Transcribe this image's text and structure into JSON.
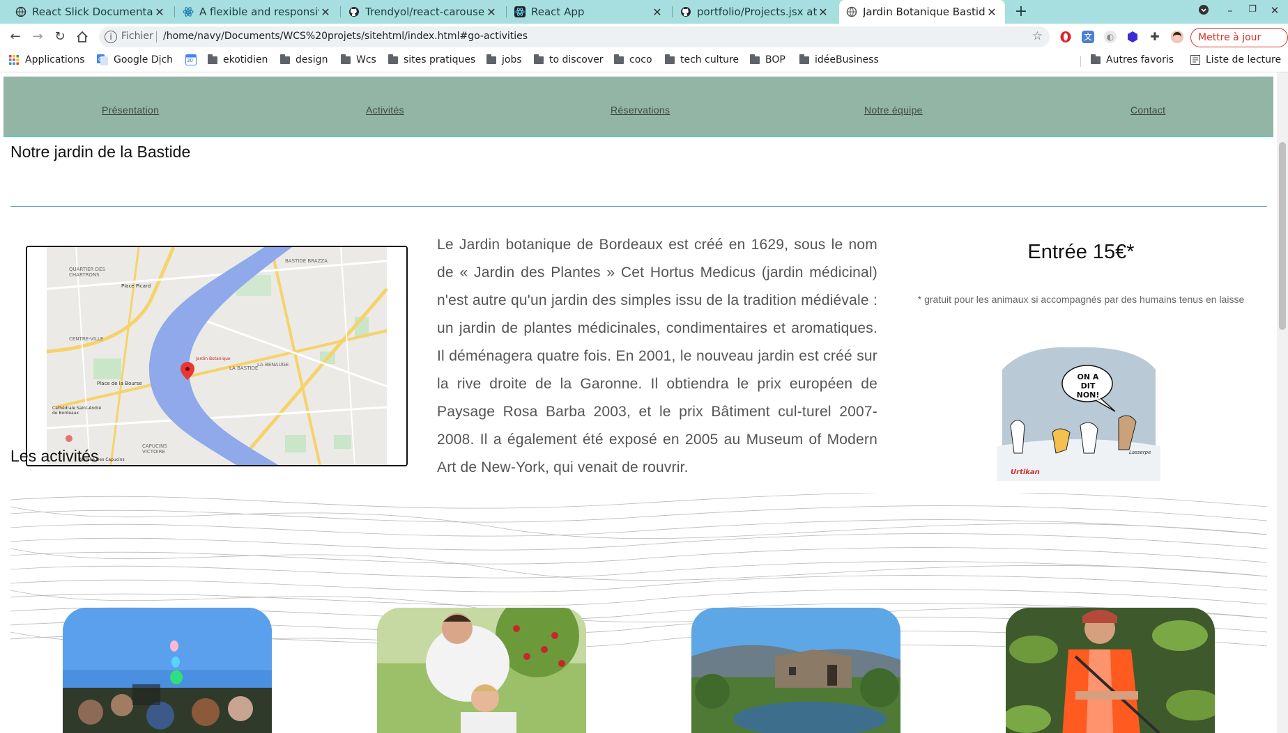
{
  "browser": {
    "tabs": [
      {
        "title": "React Slick Documentatio",
        "icon": "globe-icon"
      },
      {
        "title": "A flexible and responsive",
        "icon": "react-icon"
      },
      {
        "title": "Trendyol/react-carousel: I",
        "icon": "github-icon"
      },
      {
        "title": "React App",
        "icon": "react-icon"
      },
      {
        "title": "portfolio/Projects.jsx at n",
        "icon": "github-icon"
      },
      {
        "title": "Jardin Botanique Bastide",
        "icon": "globe-icon",
        "active": true
      }
    ],
    "new_tab": "+",
    "address": {
      "scheme": "Fichier",
      "url": "/home/navy/Documents/WCS%20projets/sitehtml/index.html#go-activities"
    },
    "update_button": "Mettre à jour",
    "bookmarks": [
      {
        "label": "Applications",
        "icon": "apps-grid-icon"
      },
      {
        "label": "Google Dịch",
        "icon": "translate-icon"
      },
      {
        "label": "",
        "icon": "calendar-icon",
        "text": "30"
      },
      {
        "label": "ekotidien",
        "icon": "folder-icon"
      },
      {
        "label": "design",
        "icon": "folder-icon"
      },
      {
        "label": "Wcs",
        "icon": "folder-icon"
      },
      {
        "label": "sites pratiques",
        "icon": "folder-icon"
      },
      {
        "label": "jobs",
        "icon": "folder-icon"
      },
      {
        "label": "to discover",
        "icon": "folder-icon"
      },
      {
        "label": "coco",
        "icon": "folder-icon"
      },
      {
        "label": "tech culture",
        "icon": "folder-icon"
      },
      {
        "label": "BOP",
        "icon": "folder-icon"
      },
      {
        "label": "idéeBusiness",
        "icon": "folder-icon"
      }
    ],
    "bookmarks_right": [
      {
        "label": "Autres favoris",
        "icon": "folder-icon"
      },
      {
        "label": "Liste de lecture",
        "icon": "reading-list-icon"
      }
    ]
  },
  "site": {
    "nav": [
      "Présentation",
      "Activités",
      "Réservations",
      "Notre équipe",
      "Contact"
    ],
    "section1_title": "Notre jardin de la Bastide",
    "description": "Le Jardin botanique de Bordeaux est créé en 1629, sous le nom de « Jardin des Plantes » Cet Hortus Medicus (jardin médicinal) n'est autre qu'un jardin des simples issu de la tradition médiévale : un jardin de plantes médicinales, condimentaires et aromatiques. Il déménagera quatre fois. En 2001, le nouveau jardin est créé sur la rive droite de la Garonne. Il obtiendra le prix européen de Paysage Rosa Barba 2003, et le prix Bâtiment cul-turel 2007-2008. Il a également été exposé en 2005 au Museum of Modern Art de New-York, qui venait de rouvrir.",
    "price_title": "Entrée 15€*",
    "price_note": "* gratuit pour les animaux si accompagnés par des humains tenus en laisse",
    "cartoon": {
      "bubble": "ON A DIT NON!",
      "brand": "Urtikan",
      "signature": "Lasserpe"
    },
    "map_labels": [
      "QUARTIER DES CHARTRONS",
      "Place Picard",
      "LA BASTIDE",
      "BASTIDE BRAZZA",
      "CENTRE-VILLE",
      "Jardin Botanique",
      "LA BENAUGE",
      "Place de la Bourse",
      "CAPUCINS VICTOIRE",
      "Marché Des Capucins",
      "Cathédrale Saint-André de Bordeaux"
    ],
    "section2_title": "Les activités",
    "activities": [
      "festival-photo",
      "tree-planting-photo",
      "stone-house-pond-photo",
      "water-lilies-photo"
    ]
  }
}
